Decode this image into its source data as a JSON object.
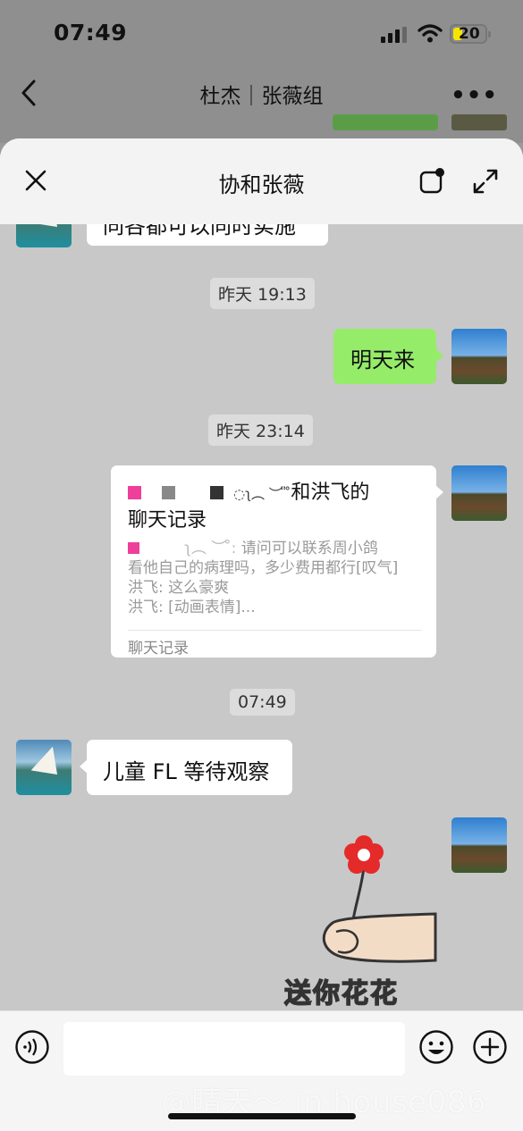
{
  "status_bar": {
    "time": "07:49",
    "battery": "20"
  },
  "background_chat": {
    "title": "杜杰｜张薇组"
  },
  "sheet": {
    "title": "协和张薇"
  },
  "messages": {
    "cut_text": "同各都可以同时实施",
    "ts1": "昨天 19:13",
    "msg1": "明天来",
    "ts2": "昨天 23:14",
    "record": {
      "title_suffix": "和洪飞的",
      "title_line2": "聊天记录",
      "lines": [
        "请问可以联系周小鸽",
        "看他自己的病理吗，多少费用都行[叹气]",
        "洪飞: 这么豪爽",
        "洪飞: [动画表情]..."
      ],
      "footer": "聊天记录"
    },
    "ts3": "07:49",
    "msg2": "儿童 FL 等待观察",
    "sticker_text": "送你花花"
  },
  "watermark": "@晴天～ in house086",
  "colors": {
    "green_bubble": "#95ec69",
    "chat_bg": "#c8c8c8"
  }
}
